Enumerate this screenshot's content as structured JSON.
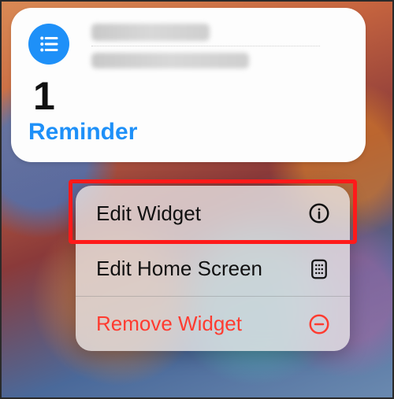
{
  "widget": {
    "count": "1",
    "label": "Reminder",
    "icon": "bullet-list-icon"
  },
  "menu": {
    "items": [
      {
        "label": "Edit Widget",
        "icon": "info-circle-icon",
        "destructive": false
      },
      {
        "label": "Edit Home Screen",
        "icon": "apps-grid-icon",
        "destructive": false
      },
      {
        "label": "Remove Widget",
        "icon": "minus-circle-icon",
        "destructive": true
      }
    ]
  },
  "colors": {
    "accent": "#1e90f8",
    "destructive": "#ff3b30"
  }
}
